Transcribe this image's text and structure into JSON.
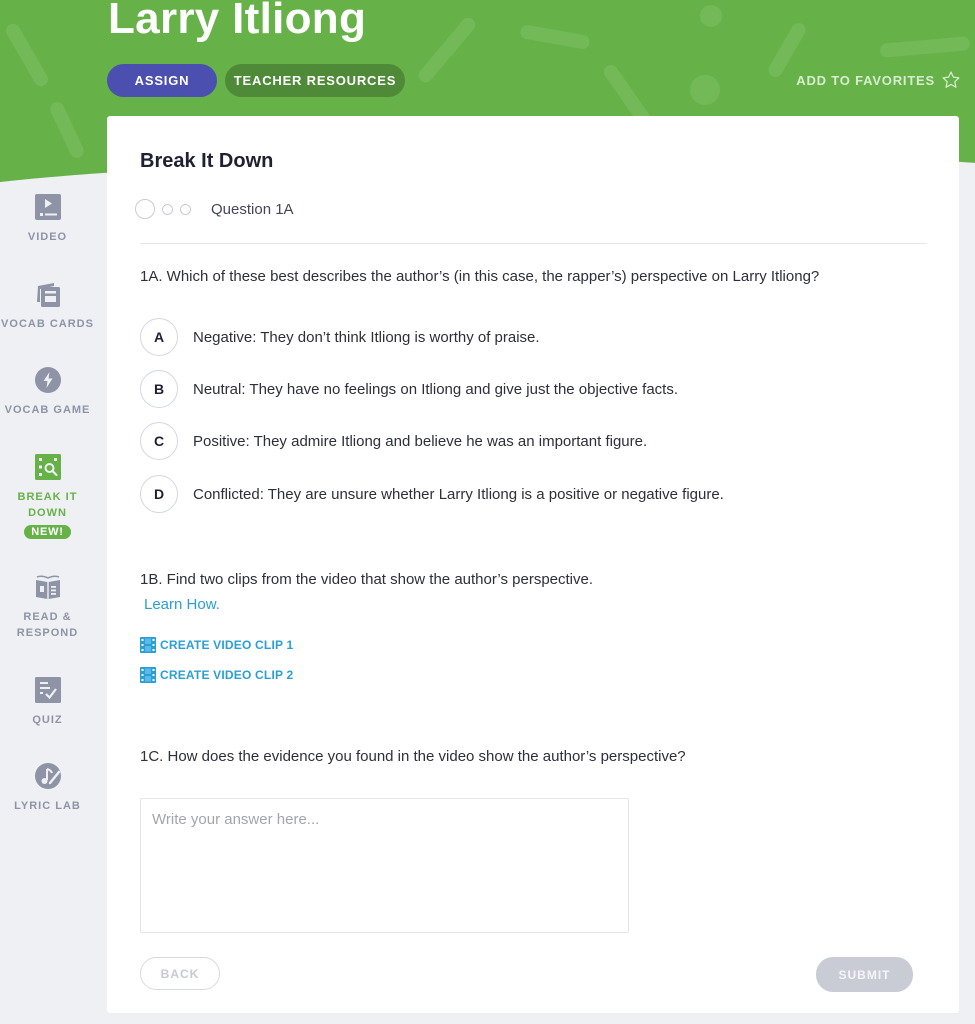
{
  "header": {
    "title": "Larry Itliong",
    "assign_label": "ASSIGN",
    "teacher_resources_label": "TEACHER RESOURCES",
    "favorites_label": "ADD TO FAVORITES",
    "favorites_icon": "star-outline-icon"
  },
  "colors": {
    "brand_green": "#66b248",
    "assign_purple": "#4a4fb0",
    "link_blue": "#2a9fd6",
    "sidebar_gray": "#8e93a6"
  },
  "sidebar": {
    "items": [
      {
        "label": "VIDEO",
        "icon": "video-icon",
        "active": false
      },
      {
        "label": "VOCAB CARDS",
        "icon": "vocab-cards-icon",
        "active": false
      },
      {
        "label": "VOCAB GAME",
        "icon": "lightning-icon",
        "active": false
      },
      {
        "label": "BREAK IT DOWN",
        "icon": "break-it-down-icon",
        "active": true,
        "badge": "NEW!"
      },
      {
        "label": "READ & RESPOND",
        "icon": "book-icon",
        "active": false
      },
      {
        "label": "QUIZ",
        "icon": "quiz-icon",
        "active": false
      },
      {
        "label": "LYRIC LAB",
        "icon": "lyric-lab-icon",
        "active": false
      }
    ]
  },
  "main": {
    "title": "Break It Down",
    "progress_label": "Question 1A",
    "q1a": {
      "text": "1A. Which of these best describes the author’s (in this case, the rapper’s) perspective on Larry Itliong?",
      "choices": [
        {
          "letter": "A",
          "text": "Negative: They don’t think Itliong is worthy of praise."
        },
        {
          "letter": "B",
          "text": "Neutral: They have no feelings on Itliong and give just the objective facts."
        },
        {
          "letter": "C",
          "text": "Positive: They admire Itliong and believe he was an important figure."
        },
        {
          "letter": "D",
          "text": "Conflicted: They are unsure whether Larry Itliong is a positive or negative figure."
        }
      ]
    },
    "q1b": {
      "text": "1B. Find two clips from the video that show the author’s perspective.",
      "learn_how": "Learn How.",
      "clip1": "CREATE VIDEO CLIP 1",
      "clip2": "CREATE VIDEO CLIP 2"
    },
    "q1c": {
      "text": "1C. How does the evidence you found in the video show the author’s perspective?",
      "answer_value": "",
      "answer_placeholder": "Write your answer here..."
    },
    "back_label": "BACK",
    "submit_label": "SUBMIT"
  }
}
